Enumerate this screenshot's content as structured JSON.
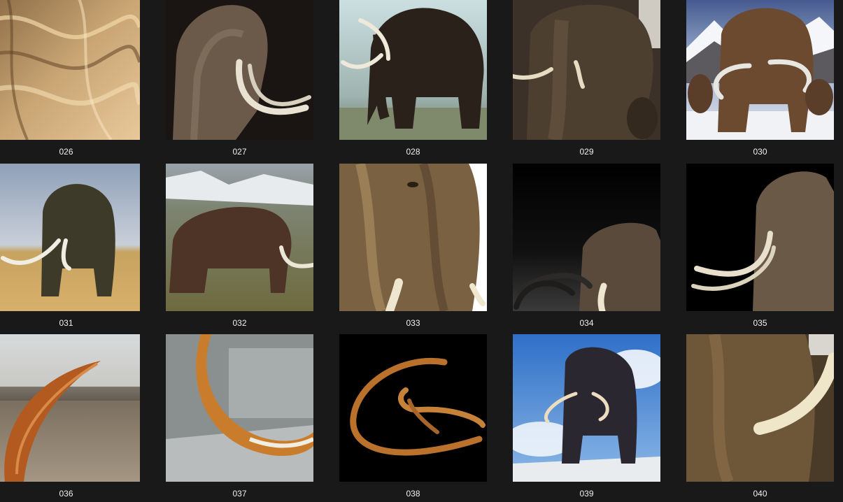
{
  "window": {
    "background": "#191919",
    "caption_color": "#f0f0f0"
  },
  "thumbnails": [
    {
      "label": "026",
      "subject": "mammoth-fur-closeup"
    },
    {
      "label": "027",
      "subject": "mammoth-dark-background"
    },
    {
      "label": "028",
      "subject": "mammoth-museum-model"
    },
    {
      "label": "029",
      "subject": "mammoth-museum-exhibit"
    },
    {
      "label": "030",
      "subject": "mammoth-herd-snow"
    },
    {
      "label": "031",
      "subject": "mammoth-grassland"
    },
    {
      "label": "032",
      "subject": "mammoth-tundra-hillside"
    },
    {
      "label": "033",
      "subject": "mammoth-face-closeup"
    },
    {
      "label": "034",
      "subject": "mammoth-black-background"
    },
    {
      "label": "035",
      "subject": "mammoth-black-background-tusks"
    },
    {
      "label": "036",
      "subject": "tusk-in-taiga"
    },
    {
      "label": "037",
      "subject": "tusk-in-ice"
    },
    {
      "label": "038",
      "subject": "pair-of-tusks"
    },
    {
      "label": "039",
      "subject": "mammoth-blue-sky"
    },
    {
      "label": "040",
      "subject": "mammoth-tusk-closeup"
    }
  ]
}
